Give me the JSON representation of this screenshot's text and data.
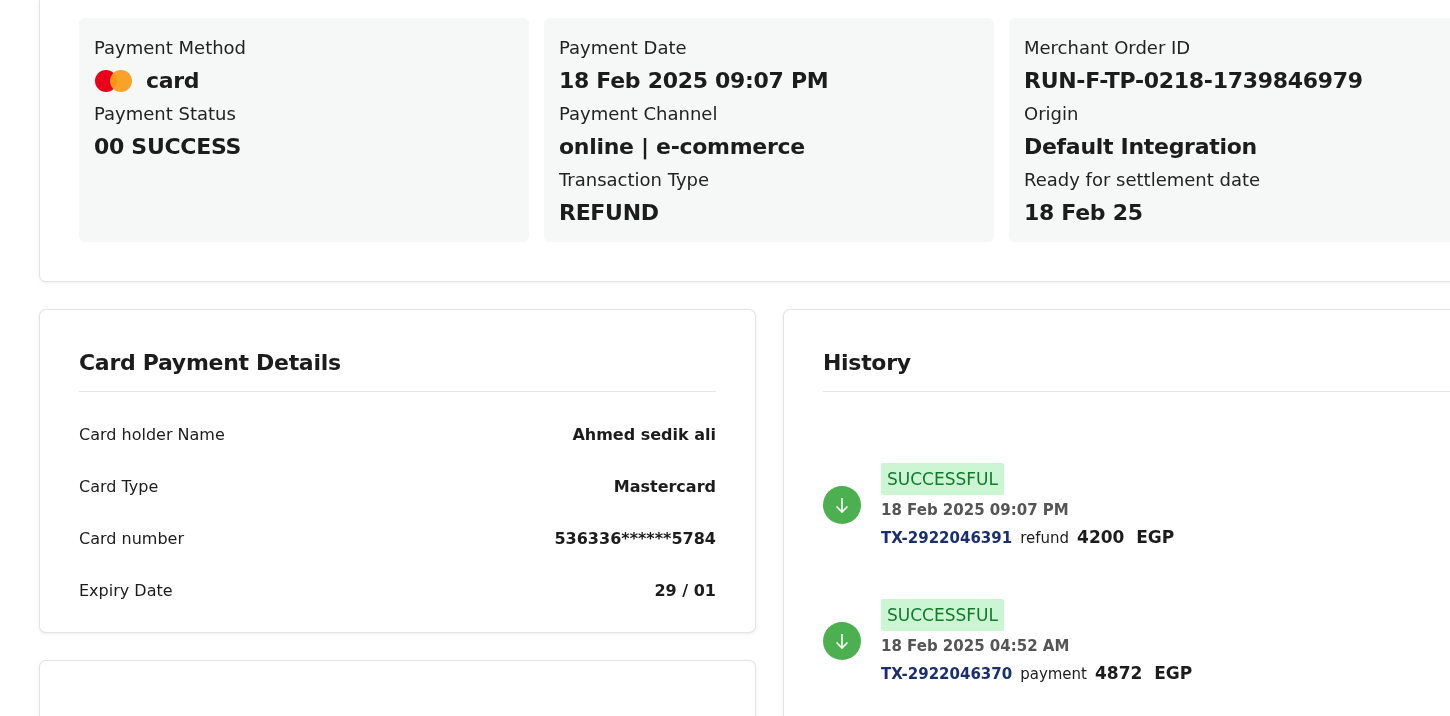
{
  "summary_panels": [
    {
      "fields": [
        {
          "kind": "method",
          "label": "Payment Method",
          "value": "card"
        },
        {
          "kind": "text",
          "label": "Payment Status",
          "value": "00 SUCCESS"
        }
      ]
    },
    {
      "fields": [
        {
          "kind": "text",
          "label": "Payment Date",
          "value": "18 Feb 2025 09:07 PM"
        },
        {
          "kind": "text",
          "label": "Payment Channel",
          "value": "online | e-commerce"
        },
        {
          "kind": "text",
          "label": "Transaction Type",
          "value": "REFUND"
        }
      ]
    },
    {
      "fields": [
        {
          "kind": "text",
          "label": "Merchant Order ID",
          "value": "RUN-F-TP-0218-1739846979"
        },
        {
          "kind": "text",
          "label": "Origin",
          "value": "Default Integration"
        },
        {
          "kind": "text",
          "label": "Ready for settlement date",
          "value": "18 Feb 25"
        }
      ]
    }
  ],
  "card_details": {
    "title": "Card Payment Details",
    "rows": [
      {
        "label": "Card holder Name",
        "value": "Ahmed sedik ali"
      },
      {
        "label": "Card Type",
        "value": "Mastercard"
      },
      {
        "label": "Card number",
        "value": "536336******5784"
      },
      {
        "label": "Expiry Date",
        "value": "29 / 01"
      }
    ]
  },
  "history": {
    "title": "History",
    "items": [
      {
        "status": "SUCCESSFUL",
        "date": "18 Feb 2025 09:07 PM",
        "transaction_id": "TX-2922046391",
        "type": "refund",
        "amount": "4200",
        "currency": "EGP"
      },
      {
        "status": "SUCCESSFUL",
        "date": "18 Feb 2025 04:52 AM",
        "transaction_id": "TX-2922046370",
        "type": "payment",
        "amount": "4872",
        "currency": "EGP"
      }
    ]
  }
}
